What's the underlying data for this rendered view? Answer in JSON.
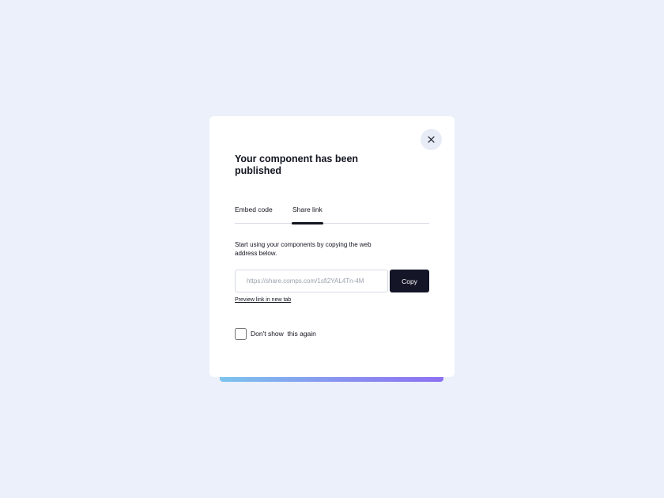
{
  "modal": {
    "title": "Your component has been published",
    "close_icon": "close-icon",
    "tabs": [
      {
        "label": "Embed code",
        "active": false
      },
      {
        "label": "Share link",
        "active": true
      }
    ],
    "description": "Start using your components by copying the web address below.",
    "url_field": {
      "value": "",
      "placeholder": "https://share.comps.com/1sfi2YAL4Tn-4M"
    },
    "copy_label": "Copy",
    "preview_link": "Preview link in new tab",
    "checkbox": {
      "label": "Don't show  this again",
      "checked": false
    }
  },
  "colors": {
    "page_background": "#ecf0fa",
    "modal_background": "#ffffff",
    "primary_dark": "#141627",
    "close_button_background": "#e7ecf6",
    "accent_gradient_start": "#7cc4ee",
    "accent_gradient_end": "#8c70f2"
  }
}
